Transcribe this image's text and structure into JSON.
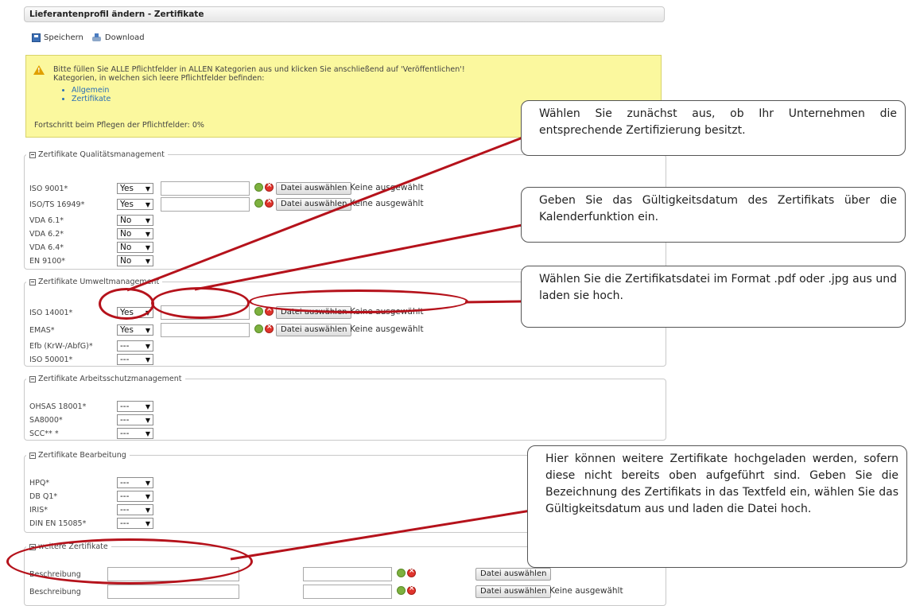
{
  "page": {
    "title": "Lieferantenprofil ändern - Zertifikate",
    "toolbar": {
      "save_label": "Speichern",
      "download_label": "Download"
    }
  },
  "notice": {
    "line1": "Bitte füllen Sie ALLE Pflichtfelder in ALLEN Kategorien aus und klicken Sie anschließend auf 'Veröffentlichen'!",
    "line2": "Kategorien, in welchen sich leere Pflichtfelder befinden:",
    "links": [
      "Allgemein",
      "Zertifikate"
    ],
    "progress": "Fortschritt beim Pflegen der Pflichtfelder: 0%"
  },
  "file_button_label": "Datei auswählen",
  "file_status": "Keine ausgewählt",
  "groups": {
    "quality": {
      "legend": "Zertifikate Qualitätsmanagement",
      "rows": [
        {
          "label": "ISO 9001*",
          "value": "Yes"
        },
        {
          "label": "ISO/TS 16949*",
          "value": "Yes"
        },
        {
          "label": "VDA 6.1*",
          "value": "No"
        },
        {
          "label": "VDA 6.2*",
          "value": "No"
        },
        {
          "label": "VDA 6.4*",
          "value": "No"
        },
        {
          "label": "EN 9100*",
          "value": "No"
        }
      ]
    },
    "environment": {
      "legend": "Zertifikate Umweltmanagement",
      "rows": [
        {
          "label": "ISO 14001*",
          "value": "Yes"
        },
        {
          "label": "EMAS*",
          "value": "Yes"
        },
        {
          "label": "Efb (KrW-/AbfG)*",
          "value": "---"
        },
        {
          "label": "ISO 50001*",
          "value": "---"
        }
      ]
    },
    "safety": {
      "legend": "Zertifikate Arbeitsschutzmanagement",
      "rows": [
        {
          "label": "OHSAS 18001*",
          "value": "---"
        },
        {
          "label": "SA8000*",
          "value": "---"
        },
        {
          "label": "SCC** *",
          "value": "---"
        }
      ]
    },
    "processing": {
      "legend": "Zertifikate Bearbeitung",
      "rows": [
        {
          "label": "HPQ*",
          "value": "---"
        },
        {
          "label": "DB Q1*",
          "value": "---"
        },
        {
          "label": "IRIS*",
          "value": "---"
        },
        {
          "label": "DIN EN 15085*",
          "value": "---"
        }
      ]
    },
    "other": {
      "legend": "weitere Zertifikate",
      "rows": [
        {
          "label": "Beschreibung"
        },
        {
          "label": "Beschreibung"
        }
      ]
    }
  },
  "callouts": [
    "Wählen Sie zunächst aus, ob Ihr Unternehmen die entsprechende Zertifizierung besitzt.",
    "Geben Sie das Gültigkeitsdatum des Zertifikats über die Kalenderfunktion ein.",
    "Wählen Sie die Zertifikatsdatei im Format .pdf oder .jpg aus und laden sie hoch.",
    "Hier können weitere Zertifikate hochgeladen werden, sofern diese nicht bereits oben aufgeführt sind. Geben Sie die Bezeichnung des Zertifikats in das Textfeld ein, wählen Sie das Gültigkeitsdatum aus und laden die Datei hoch."
  ],
  "colors": {
    "highlight": "#b5121b",
    "notice_bg": "#fbf89e",
    "link": "#2a6eb5"
  }
}
